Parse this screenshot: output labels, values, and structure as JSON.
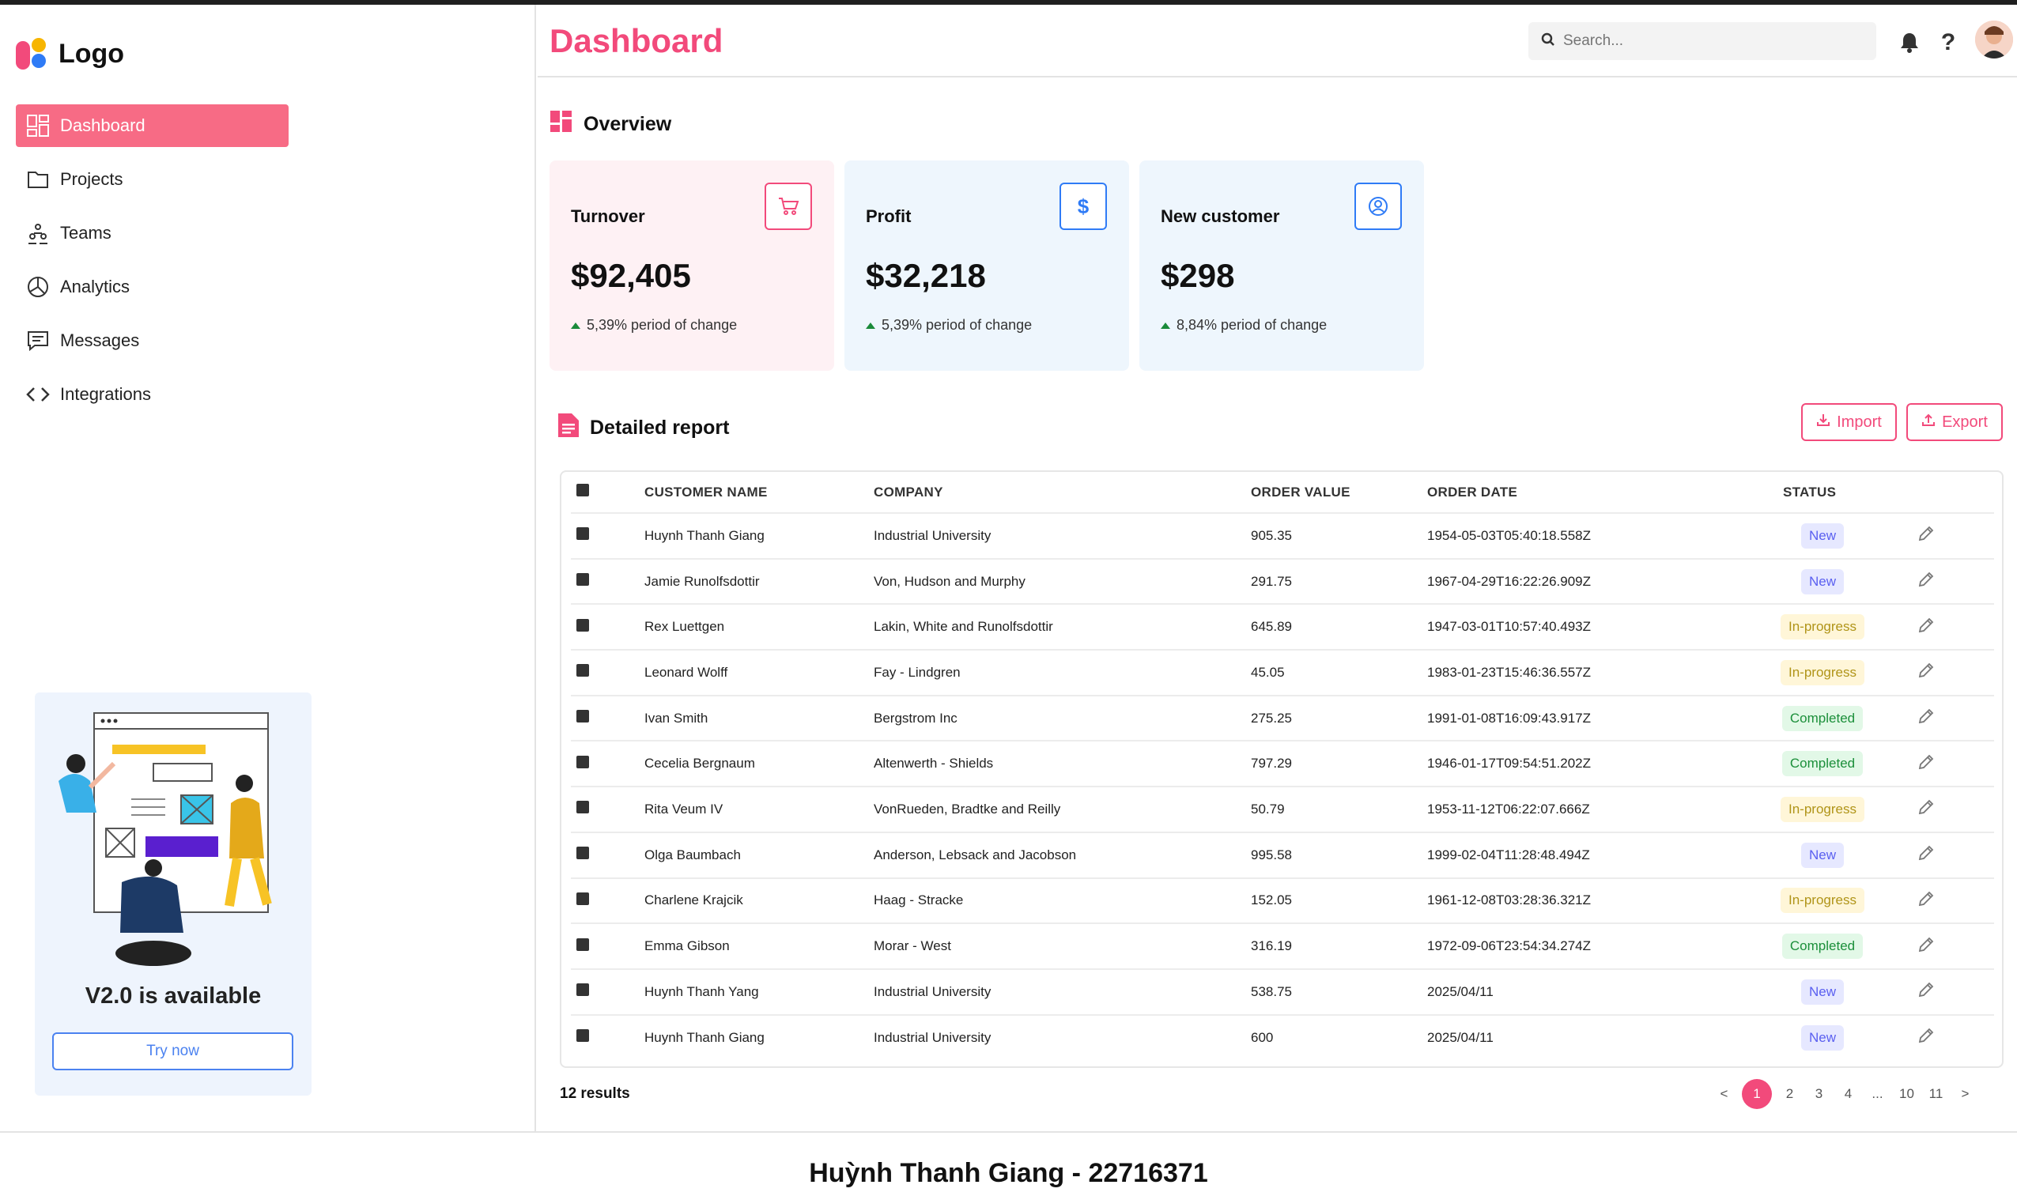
{
  "sidebar": {
    "logo_text": "Logo",
    "items": [
      {
        "label": "Dashboard",
        "icon": "dashboard-icon",
        "active": true
      },
      {
        "label": "Projects",
        "icon": "folder-icon"
      },
      {
        "label": "Teams",
        "icon": "teams-icon"
      },
      {
        "label": "Analytics",
        "icon": "pie-chart-icon"
      },
      {
        "label": "Messages",
        "icon": "message-icon"
      },
      {
        "label": "Integrations",
        "icon": "code-icon"
      }
    ],
    "promo": {
      "title": "V2.0 is available",
      "button": "Try now"
    }
  },
  "header": {
    "title": "Dashboard",
    "search_placeholder": "Search...",
    "icons": [
      "bell-icon",
      "help-icon",
      "avatar"
    ]
  },
  "overview": {
    "title": "Overview",
    "cards": [
      {
        "label": "Turnover",
        "value": "$92,405",
        "change": "5,39% period of change",
        "icon": "cart-icon",
        "accent": "#f24a7b",
        "bg": "#fef1f4"
      },
      {
        "label": "Profit",
        "value": "$32,218",
        "change": "5,39% period of change",
        "icon": "dollar-icon",
        "accent": "#2f7bf6",
        "bg": "#eef6fd"
      },
      {
        "label": "New customer",
        "value": "$298",
        "change": "8,84% period of change",
        "icon": "user-circle-icon",
        "accent": "#2f7bf6",
        "bg": "#eef6fd"
      }
    ]
  },
  "report": {
    "title": "Detailed report",
    "import_label": "Import",
    "export_label": "Export",
    "columns": [
      "CUSTOMER NAME",
      "COMPANY",
      "ORDER VALUE",
      "ORDER DATE",
      "STATUS"
    ],
    "rows": [
      {
        "name": "Huynh Thanh Giang",
        "company": "Industrial University",
        "value": "905.35",
        "date": "1954-05-03T05:40:18.558Z",
        "status": "New"
      },
      {
        "name": "Jamie Runolfsdottir",
        "company": "Von, Hudson and Murphy",
        "value": "291.75",
        "date": "1967-04-29T16:22:26.909Z",
        "status": "New"
      },
      {
        "name": "Rex Luettgen",
        "company": "Lakin, White and Runolfsdottir",
        "value": "645.89",
        "date": "1947-03-01T10:57:40.493Z",
        "status": "In-progress"
      },
      {
        "name": "Leonard Wolff",
        "company": "Fay - Lindgren",
        "value": "45.05",
        "date": "1983-01-23T15:46:36.557Z",
        "status": "In-progress"
      },
      {
        "name": "Ivan Smith",
        "company": "Bergstrom Inc",
        "value": "275.25",
        "date": "1991-01-08T16:09:43.917Z",
        "status": "Completed"
      },
      {
        "name": "Cecelia Bergnaum",
        "company": "Altenwerth - Shields",
        "value": "797.29",
        "date": "1946-01-17T09:54:51.202Z",
        "status": "Completed"
      },
      {
        "name": "Rita Veum IV",
        "company": "VonRueden, Bradtke and Reilly",
        "value": "50.79",
        "date": "1953-11-12T06:22:07.666Z",
        "status": "In-progress"
      },
      {
        "name": "Olga Baumbach",
        "company": "Anderson, Lebsack and Jacobson",
        "value": "995.58",
        "date": "1999-02-04T11:28:48.494Z",
        "status": "New"
      },
      {
        "name": "Charlene Krajcik",
        "company": "Haag - Stracke",
        "value": "152.05",
        "date": "1961-12-08T03:28:36.321Z",
        "status": "In-progress"
      },
      {
        "name": "Emma Gibson",
        "company": "Morar - West",
        "value": "316.19",
        "date": "1972-09-06T23:54:34.274Z",
        "status": "Completed"
      },
      {
        "name": "Huynh Thanh Yang",
        "company": "Industrial University",
        "value": "538.75",
        "date": "2025/04/11",
        "status": "New"
      },
      {
        "name": "Huynh Thanh Giang",
        "company": "Industrial University",
        "value": "600",
        "date": "2025/04/11",
        "status": "New"
      }
    ],
    "results": "12 results",
    "pagination": [
      "<",
      "1",
      "2",
      "3",
      "4",
      "...",
      "10",
      "11",
      ">"
    ],
    "current_page": "1"
  },
  "footer": {
    "text": "Huỳnh Thanh Giang - 22716371"
  }
}
